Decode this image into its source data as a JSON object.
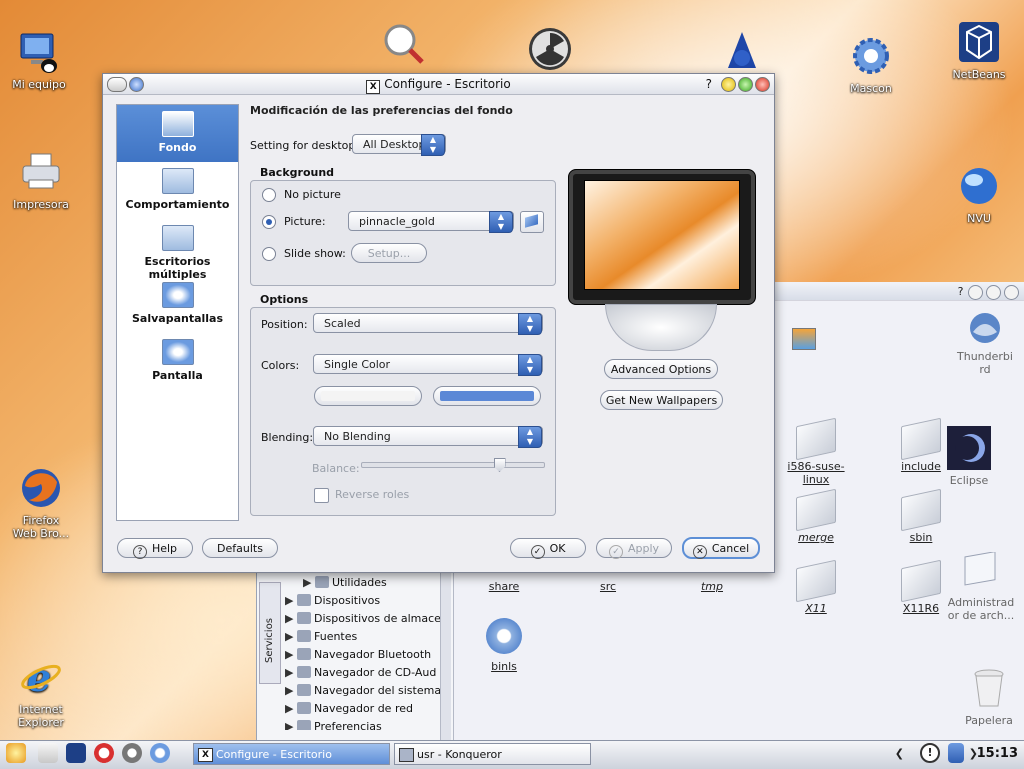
{
  "desktop": {
    "icons": [
      {
        "label": "Mi equipo",
        "icon": "computer-icon"
      },
      {
        "label": "Impresora",
        "icon": "printer-icon"
      },
      {
        "label": "Firefox\nWeb Bro...",
        "icon": "firefox-icon"
      },
      {
        "label": "Internet\nExplorer",
        "icon": "ie-icon"
      },
      {
        "label": "Mascon",
        "icon": "gear-icon"
      },
      {
        "label": "NetBeans",
        "icon": "netbeans-icon"
      },
      {
        "label": "NVU",
        "icon": "globe-icon"
      },
      {
        "label": "Eclipse",
        "icon": "eclipse-icon"
      },
      {
        "label": "Administrad\nor de arch...",
        "icon": "file-manager-icon"
      },
      {
        "label": "Papelera",
        "icon": "trash-icon"
      },
      {
        "label": "Thunderbi\nrd",
        "icon": "thunderbird-icon"
      }
    ]
  },
  "konqueror": {
    "tree": [
      "Utilidades",
      "Dispositivos",
      "Dispositivos de almace",
      "Fuentes",
      "Navegador Bluetooth",
      "Navegador de CD-Aud",
      "Navegador del sistema",
      "Navegador de red",
      "Preferencias"
    ],
    "tab_label": "Servicios",
    "files": [
      {
        "name": "i586-suse-linux",
        "italic": false
      },
      {
        "name": "include",
        "italic": false
      },
      {
        "name": "merge",
        "italic": true
      },
      {
        "name": "sbin",
        "italic": false
      },
      {
        "name": "share",
        "italic": false
      },
      {
        "name": "src",
        "italic": false
      },
      {
        "name": "tmp",
        "italic": true
      },
      {
        "name": "X11",
        "italic": true
      },
      {
        "name": "X11R6",
        "italic": false
      },
      {
        "name": "binls",
        "italic": false
      }
    ]
  },
  "dialog": {
    "title": "Configure - Escritorio",
    "heading": "Modificación de las preferencias del fondo",
    "sidebar": [
      "Fondo",
      "Comportamiento",
      "Escritorios múltiples",
      "Salvapantallas",
      "Pantalla"
    ],
    "setting_for_desktop_label": "Setting for desktop:",
    "setting_for_desktop_value": "All Desktops",
    "background": {
      "title": "Background",
      "no_picture": "No picture",
      "picture": "Picture:",
      "picture_value": "pinnacle_gold",
      "slide_show": "Slide show:",
      "setup": "Setup...",
      "selected": "picture"
    },
    "options": {
      "title": "Options",
      "position_label": "Position:",
      "position_value": "Scaled",
      "colors_label": "Colors:",
      "colors_value": "Single Color",
      "color1": "#f4f4f4",
      "color2": "#5b88d6",
      "blending_label": "Blending:",
      "blending_value": "No Blending",
      "balance_label": "Balance:",
      "balance_level": 0.75,
      "reverse_roles": "Reverse roles"
    },
    "advanced_options": "Advanced Options",
    "get_new_wallpapers": "Get New Wallpapers",
    "buttons": {
      "help": "Help",
      "defaults": "Defaults",
      "ok": "OK",
      "apply": "Apply",
      "cancel": "Cancel"
    }
  },
  "taskbar": {
    "tasks": [
      {
        "label": "Configure - Escritorio",
        "active": true
      },
      {
        "label": "usr - Konqueror",
        "active": false
      }
    ],
    "clock": "15:13"
  }
}
